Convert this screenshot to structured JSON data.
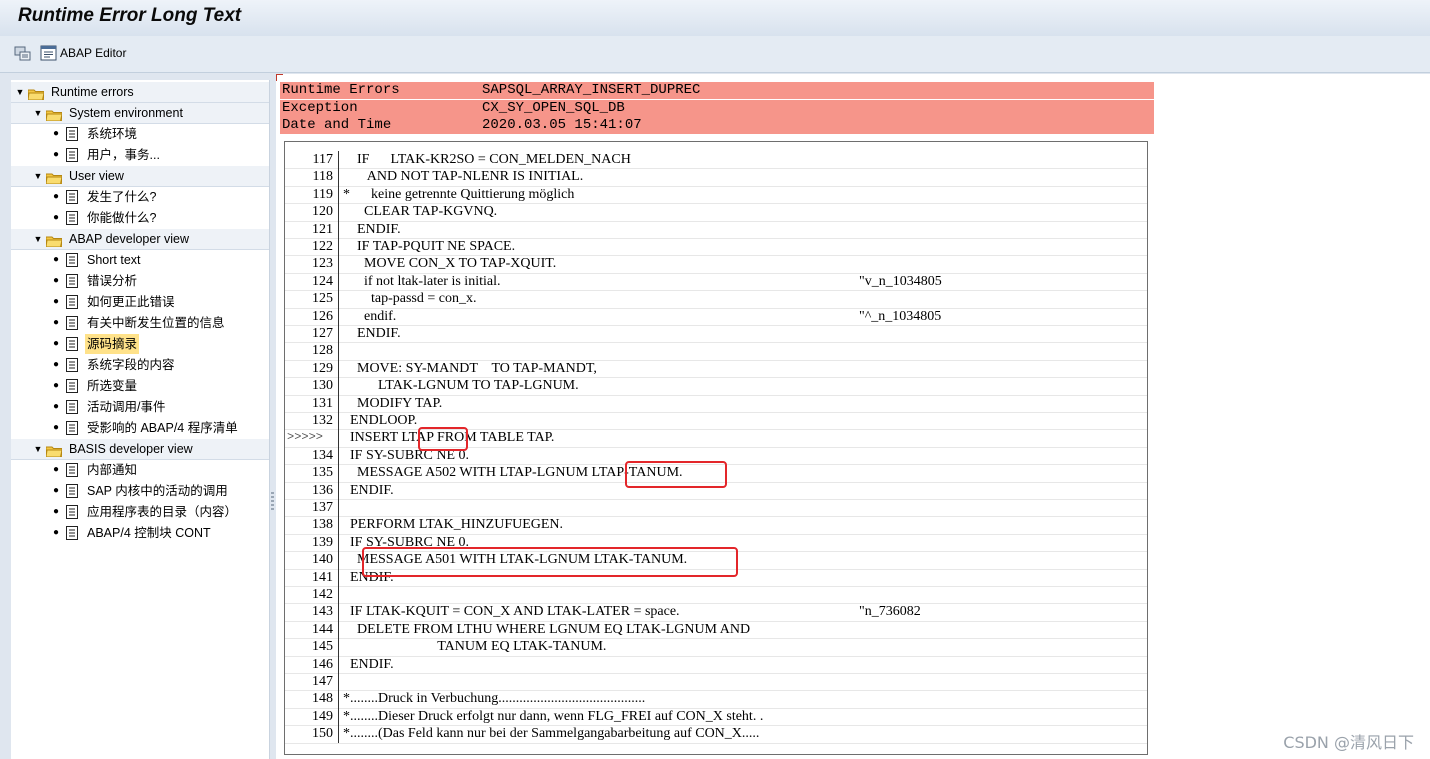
{
  "window": {
    "title": "Runtime Error Long Text"
  },
  "toolbar": {
    "abap_editor_label": "ABAP Editor"
  },
  "tree": {
    "groups": [
      {
        "label": "Runtime errors"
      },
      {
        "label": "System environment",
        "items": [
          "系统环境",
          "用户，事务..."
        ]
      },
      {
        "label": "User view",
        "items": [
          "发生了什么?",
          "你能做什么?"
        ]
      },
      {
        "label": "ABAP developer view",
        "items": [
          "Short text",
          "错误分析",
          "如何更正此错误",
          "有关中断发生位置的信息",
          "源码摘录",
          "系统字段的内容",
          "所选变量",
          "活动调用/事件",
          "受影响的 ABAP/4 程序清单"
        ]
      },
      {
        "label": "BASIS developer view",
        "items": [
          "内部通知",
          "SAP 内核中的活动的调用",
          "应用程序表的目录（内容）",
          "ABAP/4 控制块 CONT"
        ]
      }
    ],
    "selected_item": "源码摘录"
  },
  "header": [
    {
      "key": "Runtime Errors",
      "value": "SAPSQL_ARRAY_INSERT_DUPREC"
    },
    {
      "key": "Exception",
      "value": "CX_SY_OPEN_SQL_DB"
    },
    {
      "key": "Date and Time",
      "value": "2020.03.05 15:41:07"
    }
  ],
  "code": {
    "current_marker": ">>>>>",
    "lines": [
      {
        "n": "117",
        "t": "    IF      LTAK-KR2SO = CON_MELDEN_NACH",
        "r": ""
      },
      {
        "n": "118",
        "t": "       AND NOT TAP-NLENR IS INITIAL.",
        "r": ""
      },
      {
        "n": "119",
        "t": "*      keine getrennte Quittierung möglich",
        "r": ""
      },
      {
        "n": "120",
        "t": "      CLEAR TAP-KGVNQ.",
        "r": ""
      },
      {
        "n": "121",
        "t": "    ENDIF.",
        "r": ""
      },
      {
        "n": "122",
        "t": "    IF TAP-PQUIT NE SPACE.",
        "r": ""
      },
      {
        "n": "123",
        "t": "      MOVE CON_X TO TAP-XQUIT.",
        "r": ""
      },
      {
        "n": "124",
        "t": "      if not ltak-later is initial.",
        "r": "\"v_n_1034805"
      },
      {
        "n": "125",
        "t": "        tap-passd = con_x.",
        "r": ""
      },
      {
        "n": "126",
        "t": "      endif.",
        "r": "\"^_n_1034805"
      },
      {
        "n": "127",
        "t": "    ENDIF.",
        "r": ""
      },
      {
        "n": "128",
        "t": "",
        "r": ""
      },
      {
        "n": "129",
        "t": "    MOVE: SY-MANDT    TO TAP-MANDT,",
        "r": ""
      },
      {
        "n": "130",
        "t": "          LTAK-LGNUM TO TAP-LGNUM.",
        "r": ""
      },
      {
        "n": "131",
        "t": "    MODIFY TAP.",
        "r": ""
      },
      {
        "n": "132",
        "t": "  ENDLOOP.",
        "r": ""
      },
      {
        "n": "",
        "t": "  INSERT LTAP FROM TABLE TAP.",
        "r": ""
      },
      {
        "n": "134",
        "t": "  IF SY-SUBRC NE 0.",
        "r": ""
      },
      {
        "n": "135",
        "t": "    MESSAGE A502 WITH LTAP-LGNUM LTAP-TANUM.",
        "r": ""
      },
      {
        "n": "136",
        "t": "  ENDIF.",
        "r": ""
      },
      {
        "n": "137",
        "t": "",
        "r": ""
      },
      {
        "n": "138",
        "t": "  PERFORM LTAK_HINZUFUEGEN.",
        "r": ""
      },
      {
        "n": "139",
        "t": "  IF SY-SUBRC NE 0.",
        "r": ""
      },
      {
        "n": "140",
        "t": "    MESSAGE A501 WITH LTAK-LGNUM LTAK-TANUM.",
        "r": ""
      },
      {
        "n": "141",
        "t": "  ENDIF.",
        "r": ""
      },
      {
        "n": "142",
        "t": "",
        "r": ""
      },
      {
        "n": "143",
        "t": "  IF LTAK-KQUIT = CON_X AND LTAK-LATER = space.",
        "r": "\"n_736082"
      },
      {
        "n": "144",
        "t": "    DELETE FROM LTHU WHERE LGNUM EQ LTAK-LGNUM AND",
        "r": ""
      },
      {
        "n": "145",
        "t": "                           TANUM EQ LTAK-TANUM.",
        "r": ""
      },
      {
        "n": "146",
        "t": "  ENDIF.",
        "r": ""
      },
      {
        "n": "147",
        "t": "",
        "r": ""
      },
      {
        "n": "148",
        "t": "*........Druck in Verbuchung..........................................",
        "r": ""
      },
      {
        "n": "149",
        "t": "*........Dieser Druck erfolgt nur dann, wenn FLG_FREI auf CON_X steht. .",
        "r": ""
      },
      {
        "n": "150",
        "t": "*........(Das Feld kann nur bei der Sammelgangabarbeitung auf CON_X.....",
        "r": ""
      }
    ]
  },
  "watermark": "CSDN @清风日下"
}
